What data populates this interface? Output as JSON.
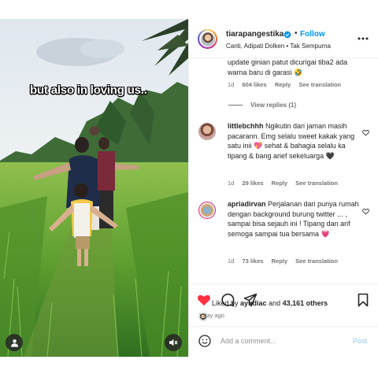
{
  "media": {
    "overlay_text": "but also in loving us..",
    "user_icon": "user-icon",
    "mute_icon": "speaker-mute-icon"
  },
  "header": {
    "username": "tiarapangestika",
    "dot": "•",
    "follow_label": "Follow",
    "subtitle": "Canti, Adipati Dolken • Tak Sempurna",
    "verified_icon": "verified-badge-icon",
    "more_icon": "more-options-icon"
  },
  "comments": [
    {
      "text": "update ginian patut dicurigai tiba2 ada warna baru di garasi 🤣",
      "time": "1d",
      "likes": "604 likes",
      "reply": "Reply",
      "translate": "See translation"
    },
    {
      "view_replies": "View replies (1)"
    },
    {
      "username": "littlebchhh",
      "text": "Ngikutin dari jaman masih pacarann. Emg selalu sweet kakak yang satu inii 💖 sehat & bahagia selalu ka tipang & bang arief sekeluarga 🖤",
      "time": "1d",
      "likes": "29 likes",
      "reply": "Reply",
      "translate": "See translation"
    },
    {
      "username": "apriadirvan",
      "text": "Perjalanan dari punya rumah dengan background burung twitter ... , sampai bisa sejauh ini ! Tipang dan arif semoga sampai tua bersama 💗",
      "time": "1d",
      "likes": "73 likes",
      "reply": "Reply",
      "translate": "See translation"
    }
  ],
  "actions": {
    "like_icon": "heart-filled-icon",
    "comment_icon": "comment-icon",
    "share_icon": "share-icon",
    "save_icon": "bookmark-icon",
    "liked_prefix": "Liked by",
    "liked_user": "ayudiac",
    "liked_and": "and",
    "liked_count": "43,161 others",
    "ago": "1 day ago"
  },
  "composer": {
    "emoji_icon": "emoji-icon",
    "placeholder": "Add a comment...",
    "post_label": "Post"
  },
  "colors": {
    "like_red": "#ff3040",
    "link_blue": "#0095f6",
    "muted": "#737373"
  }
}
